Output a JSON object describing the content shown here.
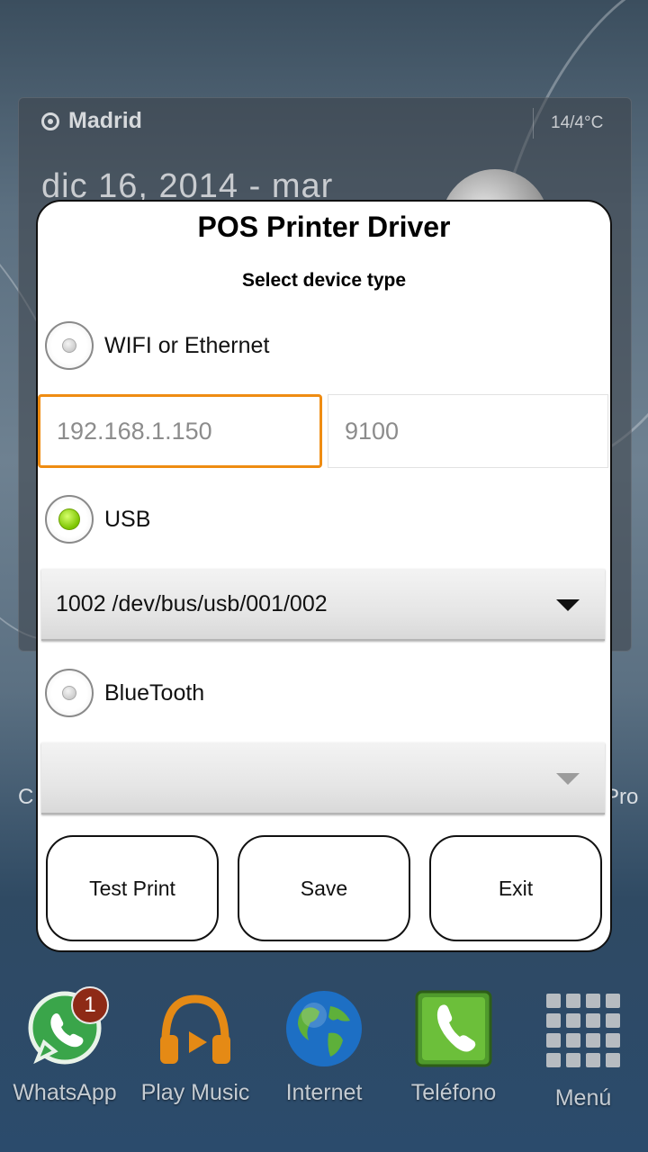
{
  "home": {
    "widget": {
      "city": "Madrid",
      "temperature": "14/4°C",
      "date": "dic 16, 2014 - mar"
    },
    "left_edge_text": "C",
    "right_edge_text": "Pro",
    "dock": [
      {
        "label": "WhatsApp",
        "icon": "whatsapp-icon",
        "badge": "1"
      },
      {
        "label": "Play Music",
        "icon": "headphones-icon"
      },
      {
        "label": "Internet",
        "icon": "globe-icon"
      },
      {
        "label": "Teléfono",
        "icon": "phone-icon"
      },
      {
        "label": "Menú",
        "icon": "apps-grid-icon"
      }
    ]
  },
  "dialog": {
    "title": "POS Printer Driver",
    "subtitle": "Select device type",
    "options": {
      "wifi": {
        "label": "WIFI or Ethernet",
        "checked": false
      },
      "usb": {
        "label": "USB",
        "checked": true
      },
      "bluetooth": {
        "label": "BlueTooth",
        "checked": false
      }
    },
    "ip_field": {
      "placeholder": "192.168.1.150"
    },
    "port_field": {
      "placeholder": "9100"
    },
    "usb_device": "1002 /dev/bus/usb/001/002",
    "bluetooth_device": "",
    "buttons": {
      "test_print": "Test Print",
      "save": "Save",
      "exit": "Exit"
    }
  },
  "colors": {
    "focus_border": "#ef8c12",
    "radio_checked": "#7cc400",
    "badge": "#8e2a16"
  }
}
